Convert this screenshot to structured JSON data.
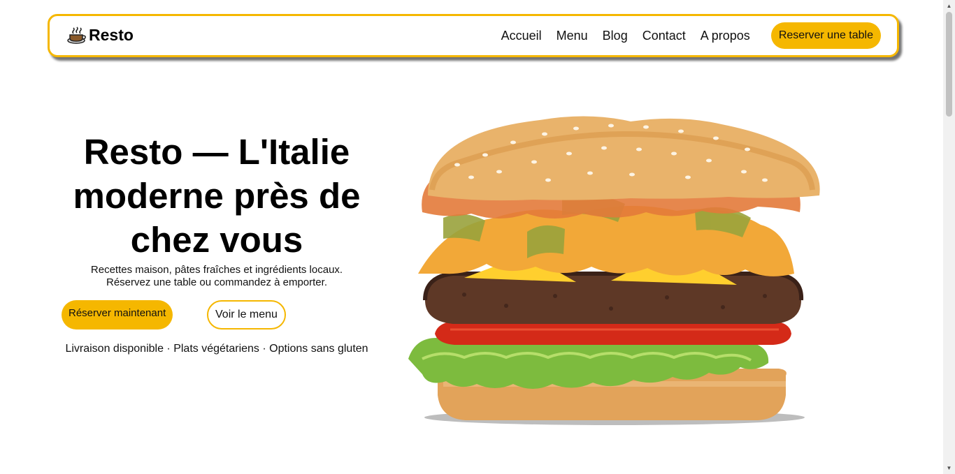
{
  "brand": {
    "name": "Resto",
    "icon": "coffee-cup-icon"
  },
  "nav": {
    "links": [
      "Accueil",
      "Menu",
      "Blog",
      "Contact",
      "A propos"
    ],
    "cta": "Reserver une table"
  },
  "hero": {
    "title": "Resto — L'Italie moderne près de chez vous",
    "subtitle_line1": "Recettes maison, pâtes fraîches et ingrédients locaux.",
    "subtitle_line2": "Réservez une table ou commandez à emporter.",
    "primary_button": "Réserver maintenant",
    "secondary_button": "Voir le menu",
    "features": "Livraison disponible · Plats végétariens · Options sans gluten",
    "image": "burger-image"
  },
  "colors": {
    "accent": "#f5b700",
    "text": "#111111",
    "background": "#ffffff"
  }
}
